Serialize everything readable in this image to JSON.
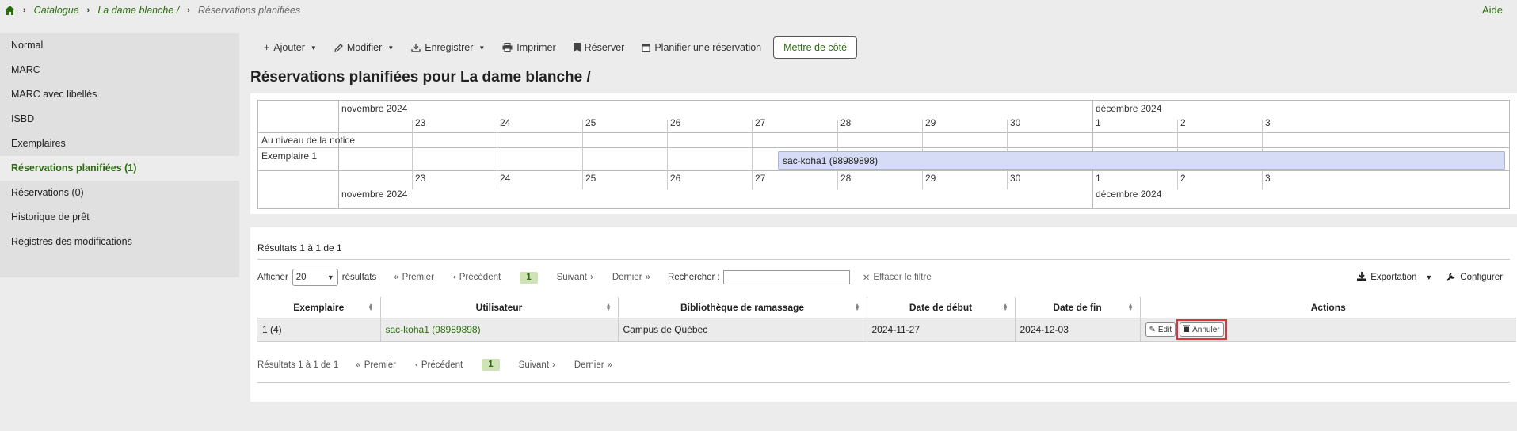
{
  "breadcrumb": {
    "items": [
      "Catalogue",
      "La dame blanche /",
      "Réservations planifiées"
    ]
  },
  "help": "Aide",
  "sidebar": {
    "items": [
      {
        "label": "Normal"
      },
      {
        "label": "MARC"
      },
      {
        "label": "MARC avec libellés"
      },
      {
        "label": "ISBD"
      },
      {
        "label": "Exemplaires"
      },
      {
        "label": "Réservations planifiées (1)",
        "active": true
      },
      {
        "label": "Réservations (0)"
      },
      {
        "label": "Historique de prêt"
      },
      {
        "label": "Registres des modifications"
      }
    ]
  },
  "toolbar": {
    "add": "Ajouter",
    "edit": "Modifier",
    "save": "Enregistrer",
    "print": "Imprimer",
    "hold": "Réserver",
    "schedule": "Planifier une réservation",
    "shelf": "Mettre de côté"
  },
  "page_title": "Réservations planifiées pour La dame blanche /",
  "timeline": {
    "month1": "novembre 2024",
    "month2": "décembre 2024",
    "days": [
      "23",
      "24",
      "25",
      "26",
      "27",
      "28",
      "29",
      "30",
      "1",
      "2",
      "3"
    ],
    "row_labels": [
      "Au niveau de la notice",
      "Exemplaire 1"
    ],
    "booking": "sac-koha1 (98989898)"
  },
  "results": {
    "count": "Résultats 1 à 1 de 1",
    "count_bottom": "Résultats 1 à 1 de 1",
    "show": "Afficher",
    "page_size": "20",
    "results_word": "résultats",
    "first": "Premier",
    "prev": "Précédent",
    "current_page": "1",
    "next": "Suivant",
    "last": "Dernier",
    "search_label": "Rechercher :",
    "search_value": "",
    "clear_filter": "Effacer le filtre",
    "export": "Exportation",
    "configure": "Configurer",
    "columns": [
      "Exemplaire",
      "Utilisateur",
      "Bibliothèque de ramassage",
      "Date de début",
      "Date de fin",
      "Actions"
    ],
    "rows": [
      {
        "item": "1 (4)",
        "patron": "sac-koha1 (98989898)",
        "library": "Campus de Québec",
        "start": "2024-11-27",
        "end": "2024-12-03"
      }
    ],
    "edit_label": "Edit",
    "cancel_label": "Annuler"
  },
  "colors": {
    "link": "#2c6e0f",
    "booking_bar": "#d6dcf5",
    "highlight": "#e0333a"
  }
}
